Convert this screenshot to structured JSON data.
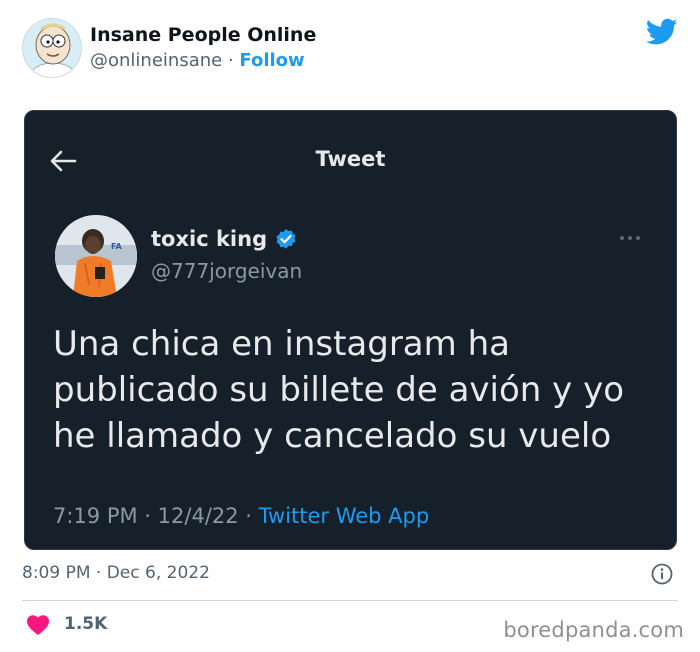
{
  "embed": {
    "author_name": "Insane People Online",
    "author_handle": "@onlineinsane",
    "separator": " · ",
    "follow_label": "Follow",
    "avatar_icon": "cartoon-character-avatar",
    "brand_icon": "twitter-bird-icon",
    "brand_color": "#1d9bf0"
  },
  "screenshot": {
    "header_title": "Tweet",
    "back_icon": "arrow-left-icon",
    "user_name": "toxic king",
    "verified_icon": "verified-badge-icon",
    "user_handle": "@777jorgeivan",
    "more_icon": "more-dots-icon",
    "text": "Una chica en instagram ha publicado su billete de avión y yo he llamado y cancelado su vuelo",
    "time": "7:19 PM",
    "dot1": " · ",
    "date": "12/4/22",
    "dot2": " · ",
    "app": "Twitter Web App",
    "background_color": "#15202b"
  },
  "footer": {
    "time": "8:09 PM",
    "separator": " · ",
    "date": "Dec 6, 2022",
    "info_icon": "info-icon",
    "heart_icon": "heart-icon",
    "likes": "1.5K",
    "watermark": "boredpanda.com"
  }
}
